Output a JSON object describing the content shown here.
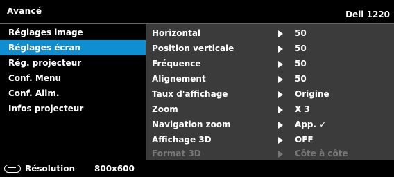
{
  "header": {
    "title": "Avancé",
    "model": "Dell 1220"
  },
  "menu": {
    "items": [
      {
        "label": "Réglages image"
      },
      {
        "label": "Réglages écran",
        "selected": true
      },
      {
        "label": "Rég. projecteur"
      },
      {
        "label": "Conf. Menu"
      },
      {
        "label": "Conf. Alim."
      },
      {
        "label": "Infos projecteur"
      }
    ]
  },
  "settings": [
    {
      "label": "Horizontal",
      "value": "50"
    },
    {
      "label": "Position verticale",
      "value": "50"
    },
    {
      "label": "Fréquence",
      "value": "50"
    },
    {
      "label": "Alignement",
      "value": "50"
    },
    {
      "label": "Taux d'affichage",
      "value": "Origine"
    },
    {
      "label": "Zoom",
      "value": "X 3"
    },
    {
      "label": "Navigation zoom",
      "value": "App.  ✓"
    },
    {
      "label": "Affichage 3D",
      "value": "OFF"
    },
    {
      "label": "Format 3D",
      "value": "Côte à côte",
      "disabled": true
    }
  ],
  "footer": {
    "label": "Résolution",
    "value": "800x600",
    "icon": "input-source-icon"
  }
}
